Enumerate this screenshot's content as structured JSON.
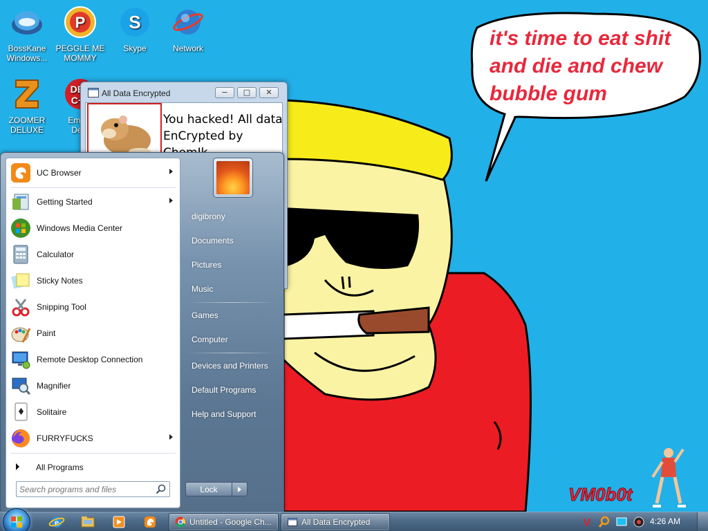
{
  "wallpaper": {
    "speech_bubble_lines": [
      "it's time to eat shit",
      "and die and chew",
      "bubble gum"
    ],
    "signature": "VM0b0t",
    "bg_color": "#22b0e8",
    "text_color": "#e8283c"
  },
  "desktop_icons": [
    {
      "label_lines": [
        "BossKane",
        "Windows..."
      ],
      "icon": "blue-orb-icon"
    },
    {
      "label_lines": [
        "PEGGLE ME",
        "MOMMY"
      ],
      "icon": "peggle-icon"
    },
    {
      "label_lines": [
        "Skype"
      ],
      "icon": "skype-icon"
    },
    {
      "label_lines": [
        "Network"
      ],
      "icon": "network-globe-icon"
    },
    {
      "label_lines": [
        "ZOOMER",
        "DELUXE"
      ],
      "icon": "zoomer-icon"
    },
    {
      "label_lines": [
        "Embar",
        "Dev-"
      ],
      "icon": "embarcadero-icon"
    }
  ],
  "popup_window": {
    "title": "All Data Encrypted",
    "message_lines": [
      "You hacked! All data",
      "EnCrypted by ChomIk"
    ],
    "minimize_label": "−",
    "maximize_label": "□",
    "close_label": "✕"
  },
  "start_menu": {
    "programs": [
      {
        "label": "UC Browser",
        "icon": "uc-browser-icon",
        "submenu": true
      },
      {
        "label": "Getting Started",
        "icon": "getting-started-icon",
        "submenu": true
      },
      {
        "label": "Windows Media Center",
        "icon": "windows-media-center-icon",
        "submenu": false
      },
      {
        "label": "Calculator",
        "icon": "calculator-icon",
        "submenu": false
      },
      {
        "label": "Sticky Notes",
        "icon": "sticky-notes-icon",
        "submenu": false
      },
      {
        "label": "Snipping Tool",
        "icon": "snipping-tool-icon",
        "submenu": false
      },
      {
        "label": "Paint",
        "icon": "paint-icon",
        "submenu": false
      },
      {
        "label": "Remote Desktop Connection",
        "icon": "remote-desktop-icon",
        "submenu": false
      },
      {
        "label": "Magnifier",
        "icon": "magnifier-icon",
        "submenu": false
      },
      {
        "label": "Solitaire",
        "icon": "solitaire-icon",
        "submenu": false
      },
      {
        "label": "FURRYFUCKS",
        "icon": "firefox-icon",
        "submenu": true
      }
    ],
    "all_programs_label": "All Programs",
    "search_placeholder": "Search programs and files",
    "right_links": [
      {
        "label": "digibrony"
      },
      {
        "label": "Documents"
      },
      {
        "label": "Pictures"
      },
      {
        "label": "Music"
      },
      {
        "label": "Games"
      },
      {
        "label": "Computer"
      },
      {
        "label": "Devices and Printers"
      },
      {
        "label": "Default Programs"
      },
      {
        "label": "Help and Support"
      }
    ],
    "lock_label": "Lock"
  },
  "taskbar": {
    "pinned": [
      "internet-explorer-icon",
      "explorer-folder-icon",
      "media-player-icon",
      "uc-browser-icon"
    ],
    "buttons": [
      {
        "label": "Untitled - Google Ch...",
        "icon": "chrome-icon"
      },
      {
        "label": "All Data Encrypted",
        "icon": "window-icon"
      }
    ],
    "tray_icons": [
      "antivirus-v-icon",
      "search-orange-icon",
      "screen-blue-icon",
      "speaker-icon"
    ],
    "clock": "4:26 AM"
  }
}
